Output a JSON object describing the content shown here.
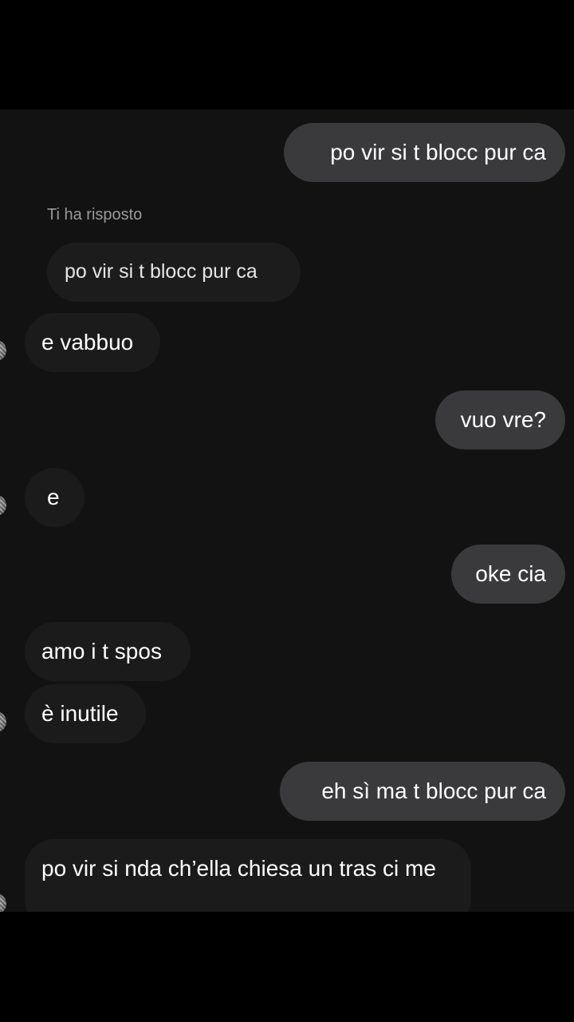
{
  "reply_label": "Ti ha risposto",
  "messages": [
    {
      "text": "po vir si t blocc pur ca"
    },
    {
      "text": "po vir si t blocc pur ca"
    },
    {
      "text": "e vabbuo"
    },
    {
      "text": "vuo vre?"
    },
    {
      "text": "e"
    },
    {
      "text": "oke cia"
    },
    {
      "text": "amo i t spos"
    },
    {
      "text": "è inutile"
    },
    {
      "text": "eh sì ma t blocc pur ca"
    },
    {
      "text": "po vir si nda  ch’ella chiesa un tras ci me"
    }
  ],
  "colors": {
    "background": "#000000",
    "chat_background": "#121212",
    "sent_bubble": "#3a3a3c",
    "received_bubble": "#1b1b1b",
    "text": "#ffffff",
    "secondary_text": "#9a9a9a"
  }
}
